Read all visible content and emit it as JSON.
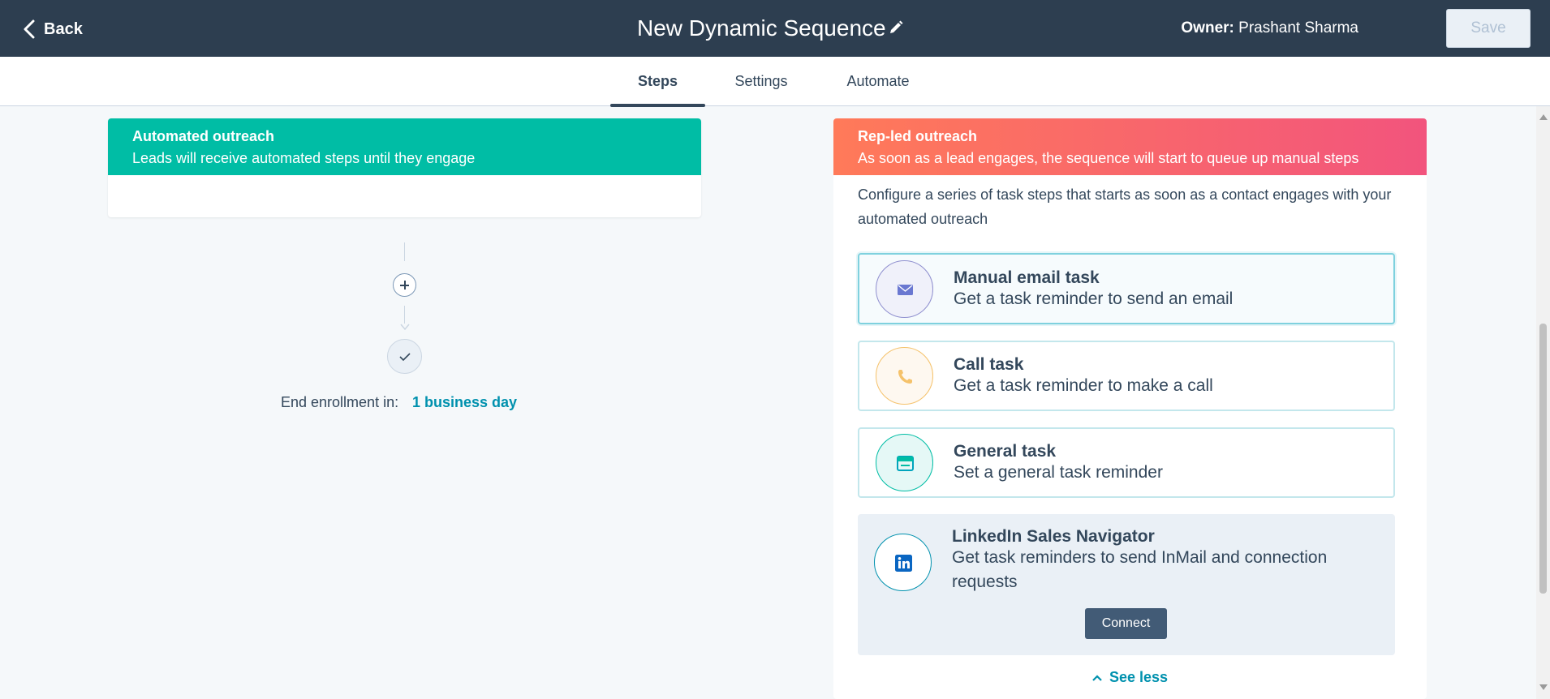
{
  "header": {
    "back_label": "Back",
    "title": "New Dynamic Sequence",
    "owner_label": "Owner:",
    "owner_name": "Prashant Sharma",
    "save_label": "Save",
    "edit_icon": "pencil-icon"
  },
  "tabs": [
    {
      "label": "Steps",
      "active": true
    },
    {
      "label": "Settings",
      "active": false
    },
    {
      "label": "Automate",
      "active": false
    }
  ],
  "automated": {
    "title": "Automated outreach",
    "description": "Leads will receive automated steps until they engage",
    "color": "#00bda5"
  },
  "flow": {
    "end_label": "End enrollment in:",
    "end_value": "1 business day"
  },
  "rep_led": {
    "title": "Rep-led outreach",
    "description": "As soon as a lead engages, the sequence will start to queue up manual steps",
    "intro": "Configure a series of task steps that starts as soon as a contact engages with your automated outreach",
    "tasks": [
      {
        "title": "Manual email task",
        "description": "Get a task reminder to send an email",
        "icon": "email-icon",
        "selected": true
      },
      {
        "title": "Call task",
        "description": "Get a task reminder to make a call",
        "icon": "phone-icon",
        "selected": false
      },
      {
        "title": "General task",
        "description": "Set a general task reminder",
        "icon": "task-icon",
        "selected": false
      }
    ],
    "linkedin": {
      "title": "LinkedIn Sales Navigator",
      "description": "Get task reminders to send InMail and connection requests",
      "button": "Connect",
      "icon": "linkedin-icon"
    },
    "see_less": "See less"
  },
  "colors": {
    "header_bg": "#2d3e50",
    "link": "#0091ae",
    "rep_gradient_start": "#ff7a59",
    "rep_gradient_end": "#f2547d"
  }
}
